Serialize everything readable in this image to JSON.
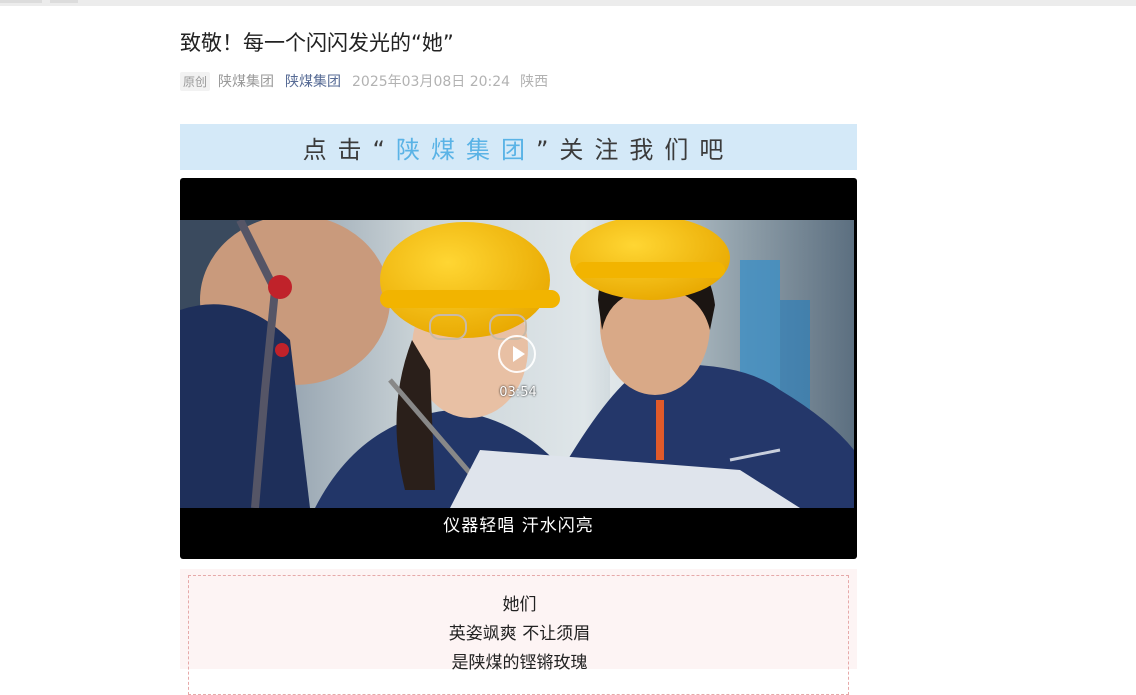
{
  "article": {
    "title": "致敬！每一个闪闪发光的“她”",
    "meta": {
      "original_badge": "原创",
      "author": "陕煤集团",
      "account": "陕煤集团",
      "datetime": "2025年03月08日 20:24",
      "location": "陕西"
    },
    "follow_banner": {
      "prefix": "点击“",
      "brand": "陕煤集团",
      "suffix": "”关注我们吧"
    },
    "video": {
      "duration": "03:54",
      "subtitle": "仪器轻唱 汗水闪亮"
    },
    "quote_lines": [
      "她们",
      "英姿飒爽 不让须眉",
      "是陕煤的铿锵玫瑰"
    ]
  },
  "colors": {
    "account_link": "#576b95",
    "banner_bg": "#d4e9f8",
    "banner_brand": "#5ab3e6",
    "quote_border": "#e6a9a9"
  }
}
